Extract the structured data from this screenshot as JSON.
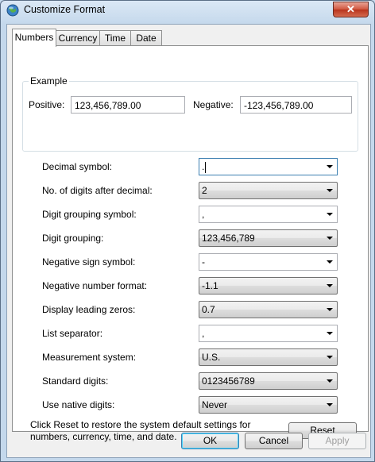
{
  "window": {
    "title": "Customize Format",
    "close_glyph": "✕"
  },
  "tabs": [
    {
      "label": "Numbers",
      "active": true
    },
    {
      "label": "Currency",
      "active": false
    },
    {
      "label": "Time",
      "active": false
    },
    {
      "label": "Date",
      "active": false
    }
  ],
  "example": {
    "legend": "Example",
    "positive_label": "Positive:",
    "positive_value": "123,456,789.00",
    "negative_label": "Negative:",
    "negative_value": "-123,456,789.00"
  },
  "settings": [
    {
      "label": "Decimal symbol:",
      "value": ".",
      "style": "editable"
    },
    {
      "label": "No. of digits after decimal:",
      "value": "2",
      "style": "dropdown"
    },
    {
      "label": "Digit grouping symbol:",
      "value": ",",
      "style": "editable"
    },
    {
      "label": "Digit grouping:",
      "value": "123,456,789",
      "style": "dropdown"
    },
    {
      "label": "Negative sign symbol:",
      "value": "-",
      "style": "editable"
    },
    {
      "label": "Negative number format:",
      "value": "-1.1",
      "style": "dropdown"
    },
    {
      "label": "Display leading zeros:",
      "value": "0.7",
      "style": "dropdown"
    },
    {
      "label": "List separator:",
      "value": ",",
      "style": "editable"
    },
    {
      "label": "Measurement system:",
      "value": "U.S.",
      "style": "dropdown"
    },
    {
      "label": "Standard digits:",
      "value": "0123456789",
      "style": "dropdown"
    },
    {
      "label": "Use native digits:",
      "value": "Never",
      "style": "dropdown"
    }
  ],
  "reset_note": "Click Reset to restore the system default settings for numbers, currency, time, and date.",
  "buttons": {
    "reset": "Reset",
    "ok": "OK",
    "cancel": "Cancel",
    "apply": "Apply"
  },
  "icons": {
    "title_icon": "globe-icon",
    "close_icon": "close-icon",
    "dropdown_icon": "chevron-down-icon"
  }
}
